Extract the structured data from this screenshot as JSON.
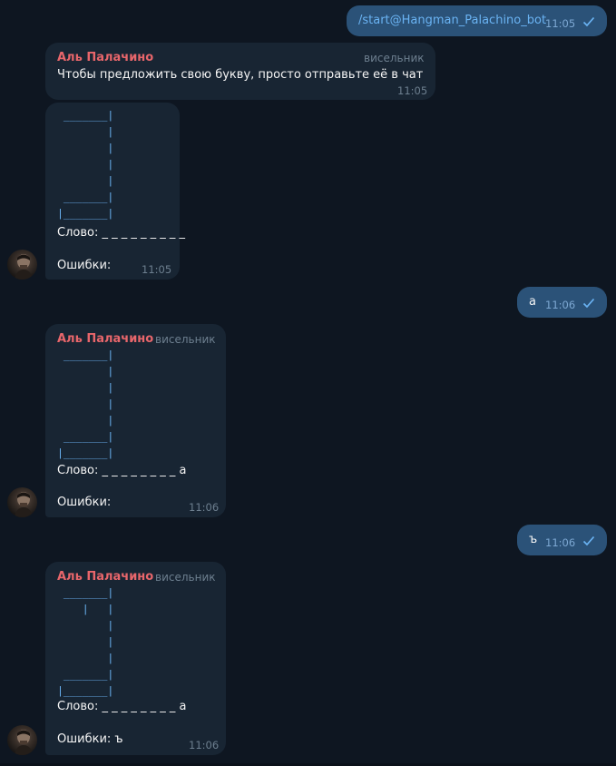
{
  "messages": [
    {
      "kind": "out",
      "text": "/start@Hangman_Palachino_bot",
      "time": "11:05"
    },
    {
      "kind": "in",
      "sender": "Аль Палачино",
      "role": "висельник",
      "text": "Чтобы предложить свою букву, просто отправьте её в чат",
      "time": "11:05"
    },
    {
      "kind": "in",
      "art": " _______|\n        |\n        |\n        |\n        |\n _______|\n|_______|",
      "word": "Слово: _ _ _ _ _ _ _ _ _",
      "errors": "Ошибки:",
      "time": "11:05"
    },
    {
      "kind": "out",
      "text": "а",
      "time": "11:06"
    },
    {
      "kind": "in",
      "sender": "Аль Палачино",
      "role": "висельник",
      "art": " _______|\n        |\n        |\n        |\n        |\n _______|\n|_______|",
      "word": "Слово: _ _ _ _ _ _ _ _ а",
      "errors": "Ошибки:",
      "time": "11:06"
    },
    {
      "kind": "out",
      "text": "ъ",
      "time": "11:06"
    },
    {
      "kind": "in",
      "sender": "Аль Палачино",
      "role": "висельник",
      "art": " _______|\n    |   |\n        |\n        |\n        |\n _______|\n|_______|",
      "word": "Слово: _ _ _ _ _ _ _ _ а",
      "errors": "Ошибки: ъ",
      "time": "11:06"
    }
  ],
  "colors": {
    "background": "#0e1621",
    "outgoing_bubble": "#2b5278",
    "incoming_bubble": "#182533",
    "sender_name": "#e8666b",
    "link": "#6ab3f3"
  },
  "icons": {
    "check": "single-check-icon",
    "avatar": "bot-avatar"
  }
}
